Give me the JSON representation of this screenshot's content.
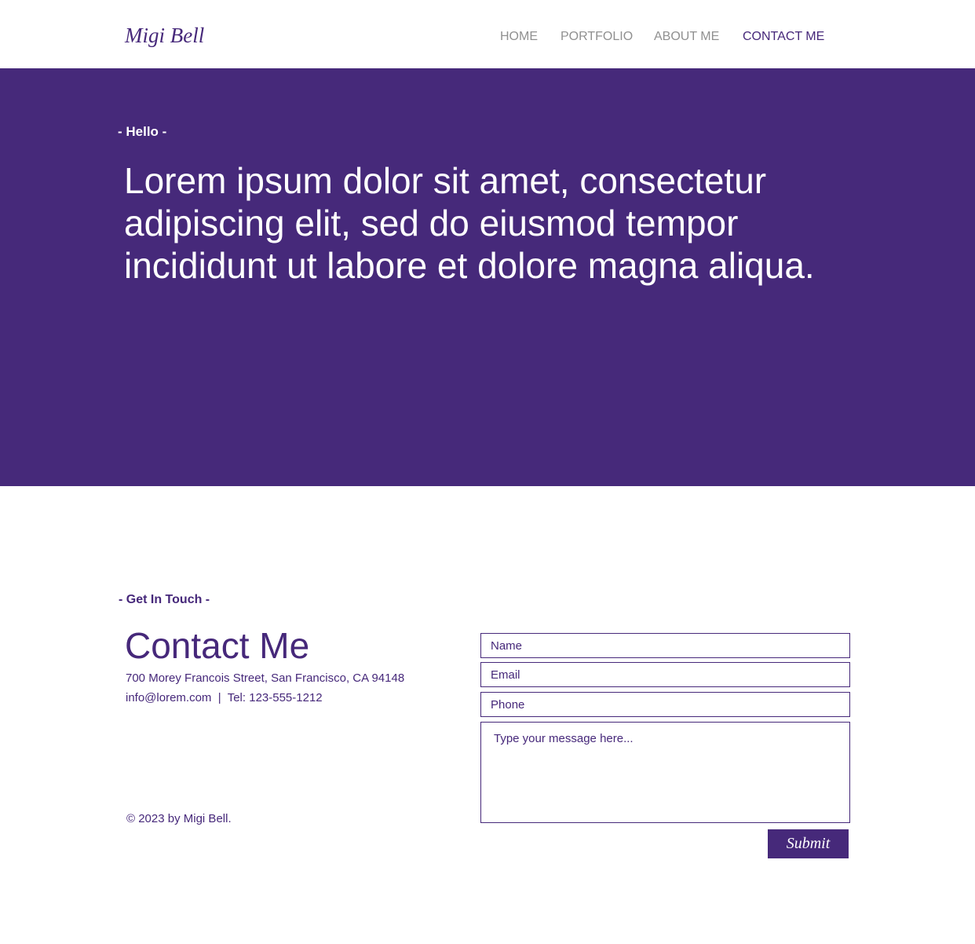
{
  "header": {
    "logo": "Migi Bell",
    "nav": {
      "home": "HOME",
      "portfolio": "PORTFOLIO",
      "about": "ABOUT ME",
      "contact": "CONTACT ME"
    },
    "active_nav": "CONTACT ME"
  },
  "hero": {
    "eyebrow": "- Hello -",
    "text": "Lorem ipsum dolor sit amet, consectetur adipiscing elit, sed do eiusmod tempor incididunt ut labore et dolore magna aliqua."
  },
  "contact": {
    "eyebrow": "- Get In Touch -",
    "title": "Contact Me",
    "address": "700 Morey Francois Street, San Francisco, CA 94148",
    "email_phone": "info@lorem.com  |  Tel: 123-555-1212",
    "copyright": "© 2023 by Migi Bell."
  },
  "form": {
    "name_placeholder": "Name",
    "email_placeholder": "Email",
    "phone_placeholder": "Phone",
    "message_placeholder": "Type your message here...",
    "submit_label": "Submit"
  },
  "colors": {
    "brand": "#46287a",
    "nav_inactive": "#909090",
    "background": "#ffffff"
  }
}
